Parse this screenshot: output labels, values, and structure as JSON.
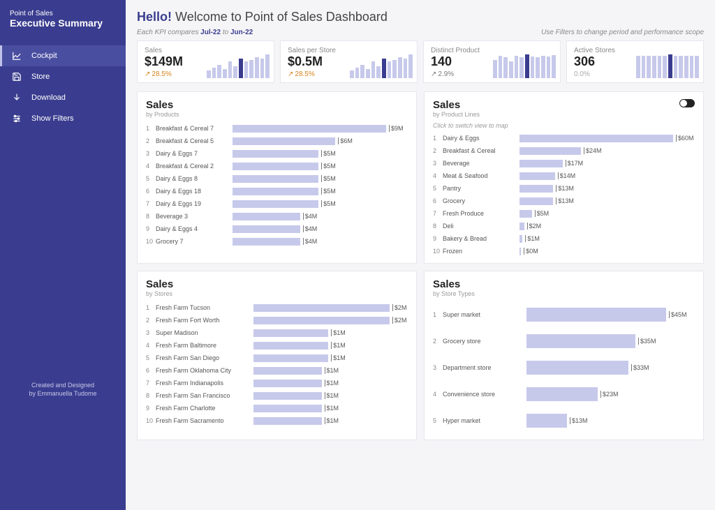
{
  "sidebar": {
    "pretitle": "Point of Sales",
    "title": "Executive Summary",
    "items": [
      {
        "label": "Cockpit"
      },
      {
        "label": "Store"
      },
      {
        "label": "Download"
      },
      {
        "label": "Show Filters"
      }
    ],
    "footer1": "Created and Designed",
    "footer2": "by Emmanuella Tudome"
  },
  "header": {
    "hello": "Hello!",
    "welcome": "Welcome to Point of Sales Dashboard",
    "compare_pre": "Each KPI compares",
    "compare_a": "Jul-22",
    "compare_mid": "to",
    "compare_b": "Jun-22",
    "filter_hint": "Use Filters to change period and performance scope"
  },
  "kpis": [
    {
      "label": "Sales",
      "value": "$149M",
      "delta": "28.5%",
      "trend": "up"
    },
    {
      "label": "Sales per Store",
      "value": "$0.5M",
      "delta": "28.5%",
      "trend": "up"
    },
    {
      "label": "Distinct Product",
      "value": "140",
      "delta": "2.9%",
      "trend": "up2"
    },
    {
      "label": "Active Stores",
      "value": "306",
      "delta": "0.0%",
      "trend": "flat"
    }
  ],
  "cards": {
    "products": {
      "title": "Sales",
      "subtitle": "by Products",
      "rows": [
        {
          "idx": "1",
          "label": "Breakfast & Cereal 7",
          "val": "$9M",
          "pct": 100
        },
        {
          "idx": "2",
          "label": "Breakfast & Cereal 5",
          "val": "$6M",
          "pct": 67
        },
        {
          "idx": "3",
          "label": "Dairy & Eggs 7",
          "val": "$5M",
          "pct": 56
        },
        {
          "idx": "4",
          "label": "Breakfast & Cereal 2",
          "val": "$5M",
          "pct": 56
        },
        {
          "idx": "5",
          "label": "Dairy & Eggs 8",
          "val": "$5M",
          "pct": 56
        },
        {
          "idx": "6",
          "label": "Dairy & Eggs 18",
          "val": "$5M",
          "pct": 56
        },
        {
          "idx": "7",
          "label": "Dairy & Eggs 19",
          "val": "$5M",
          "pct": 56
        },
        {
          "idx": "8",
          "label": "Beverage 3",
          "val": "$4M",
          "pct": 44
        },
        {
          "idx": "9",
          "label": "Dairy & Eggs 4",
          "val": "$4M",
          "pct": 44
        },
        {
          "idx": "10",
          "label": "Grocery 7",
          "val": "$4M",
          "pct": 44
        }
      ]
    },
    "product_lines": {
      "title": "Sales",
      "subtitle": "by Product Lines",
      "hint": "Click to switch view to map",
      "rows": [
        {
          "idx": "1",
          "label": "Dairy & Eggs",
          "val": "$60M",
          "pct": 100
        },
        {
          "idx": "2",
          "label": "Breakfast & Cereal",
          "val": "$24M",
          "pct": 40
        },
        {
          "idx": "3",
          "label": "Beverage",
          "val": "$17M",
          "pct": 28
        },
        {
          "idx": "4",
          "label": "Meat & Seafood",
          "val": "$14M",
          "pct": 23
        },
        {
          "idx": "5",
          "label": "Pantry",
          "val": "$13M",
          "pct": 22
        },
        {
          "idx": "6",
          "label": "Grocery",
          "val": "$13M",
          "pct": 22
        },
        {
          "idx": "7",
          "label": "Fresh Produce",
          "val": "$5M",
          "pct": 8
        },
        {
          "idx": "8",
          "label": "Deli",
          "val": "$2M",
          "pct": 3
        },
        {
          "idx": "9",
          "label": "Bakery & Bread",
          "val": "$1M",
          "pct": 2
        },
        {
          "idx": "10",
          "label": "Frozen",
          "val": "$0M",
          "pct": 1
        }
      ]
    },
    "stores": {
      "title": "Sales",
      "subtitle": "by Stores",
      "rows": [
        {
          "idx": "1",
          "label": "Fresh Farm Tucson",
          "val": "$2M",
          "pct": 100
        },
        {
          "idx": "2",
          "label": "Fresh Farm Fort Worth",
          "val": "$2M",
          "pct": 100
        },
        {
          "idx": "3",
          "label": "Super Madison",
          "val": "$1M",
          "pct": 55
        },
        {
          "idx": "4",
          "label": "Fresh Farm Baltimore",
          "val": "$1M",
          "pct": 55
        },
        {
          "idx": "5",
          "label": "Fresh Farm San Diego",
          "val": "$1M",
          "pct": 55
        },
        {
          "idx": "6",
          "label": "Fresh Farm Oklahoma City",
          "val": "$1M",
          "pct": 50
        },
        {
          "idx": "7",
          "label": "Fresh Farm Indianapolis",
          "val": "$1M",
          "pct": 50
        },
        {
          "idx": "8",
          "label": "Fresh Farm San Francisco",
          "val": "$1M",
          "pct": 50
        },
        {
          "idx": "9",
          "label": "Fresh Farm Charlotte",
          "val": "$1M",
          "pct": 50
        },
        {
          "idx": "10",
          "label": "Fresh Farm Sacramento",
          "val": "$1M",
          "pct": 50
        }
      ]
    },
    "store_types": {
      "title": "Sales",
      "subtitle": "by Store Types",
      "rows": [
        {
          "idx": "1",
          "label": "Super market",
          "val": "$45M",
          "pct": 100
        },
        {
          "idx": "2",
          "label": "Grocery store",
          "val": "$35M",
          "pct": 78
        },
        {
          "idx": "3",
          "label": "Department store",
          "val": "$33M",
          "pct": 73
        },
        {
          "idx": "4",
          "label": "Convenience store",
          "val": "$23M",
          "pct": 51
        },
        {
          "idx": "5",
          "label": "Hyper market",
          "val": "$13M",
          "pct": 29
        }
      ]
    }
  },
  "chart_data": [
    {
      "type": "bar",
      "title": "Sales by Products",
      "xlabel": "",
      "ylabel": "Sales",
      "categories": [
        "Breakfast & Cereal 7",
        "Breakfast & Cereal 5",
        "Dairy & Eggs 7",
        "Breakfast & Cereal 2",
        "Dairy & Eggs 8",
        "Dairy & Eggs 18",
        "Dairy & Eggs 19",
        "Beverage 3",
        "Dairy & Eggs 4",
        "Grocery 7"
      ],
      "values": [
        9,
        6,
        5,
        5,
        5,
        5,
        5,
        4,
        4,
        4
      ],
      "unit": "M USD",
      "ylim": [
        0,
        9
      ]
    },
    {
      "type": "bar",
      "title": "Sales by Product Lines",
      "xlabel": "",
      "ylabel": "Sales",
      "categories": [
        "Dairy & Eggs",
        "Breakfast & Cereal",
        "Beverage",
        "Meat & Seafood",
        "Pantry",
        "Grocery",
        "Fresh Produce",
        "Deli",
        "Bakery & Bread",
        "Frozen"
      ],
      "values": [
        60,
        24,
        17,
        14,
        13,
        13,
        5,
        2,
        1,
        0
      ],
      "unit": "M USD",
      "ylim": [
        0,
        60
      ]
    },
    {
      "type": "bar",
      "title": "Sales by Stores",
      "xlabel": "",
      "ylabel": "Sales",
      "categories": [
        "Fresh Farm Tucson",
        "Fresh Farm Fort Worth",
        "Super Madison",
        "Fresh Farm Baltimore",
        "Fresh Farm San Diego",
        "Fresh Farm Oklahoma City",
        "Fresh Farm Indianapolis",
        "Fresh Farm San Francisco",
        "Fresh Farm Charlotte",
        "Fresh Farm Sacramento"
      ],
      "values": [
        2,
        2,
        1,
        1,
        1,
        1,
        1,
        1,
        1,
        1
      ],
      "unit": "M USD",
      "ylim": [
        0,
        2
      ]
    },
    {
      "type": "bar",
      "title": "Sales by Store Types",
      "xlabel": "",
      "ylabel": "Sales",
      "categories": [
        "Super market",
        "Grocery store",
        "Department store",
        "Convenience store",
        "Hyper market"
      ],
      "values": [
        45,
        35,
        33,
        23,
        13
      ],
      "unit": "M USD",
      "ylim": [
        0,
        45
      ]
    }
  ]
}
